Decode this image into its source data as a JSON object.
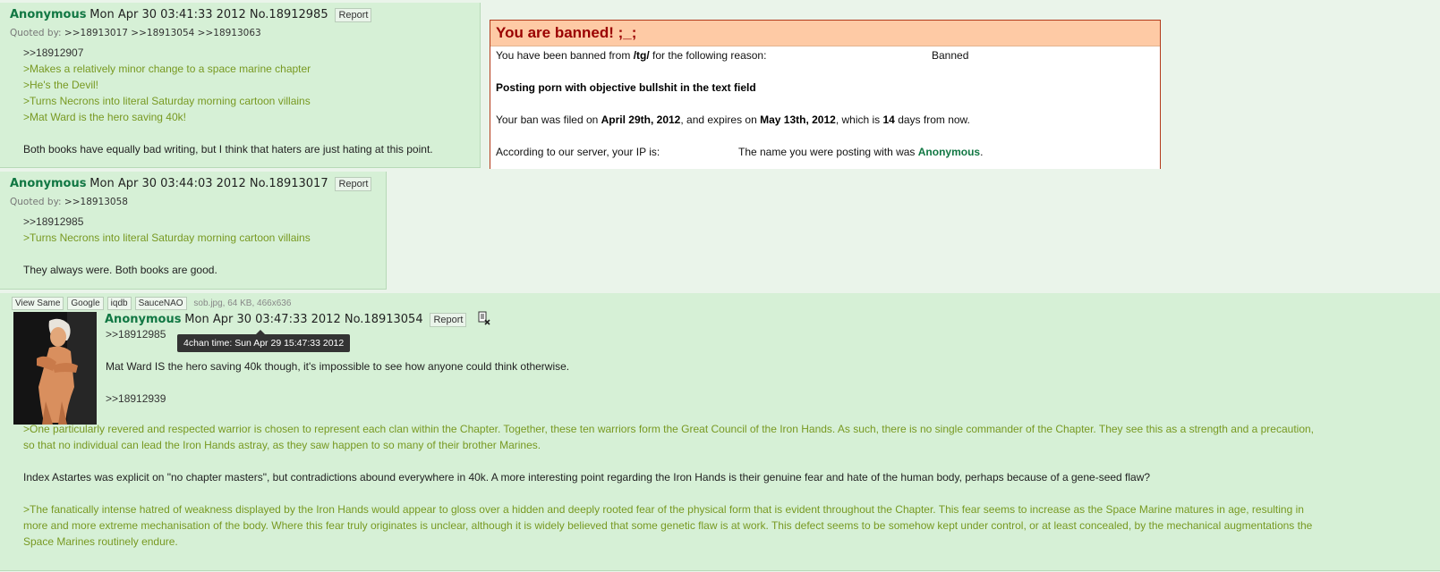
{
  "post1": {
    "name": "Anonymous",
    "date_no": "Mon Apr 30 03:41:33 2012 No.18912985",
    "report_label": "Report",
    "quoted_by_label": "Quoted by:",
    "quoted_by": ">>18913017 >>18913054 >>18913063",
    "lines": [
      ">>18912907",
      ">Makes a relatively minor change to a space marine chapter",
      ">He's the Devil!",
      ">Turns Necrons into literal Saturday morning cartoon villains",
      ">Mat Ward is the hero saving 40k!",
      "",
      "Both books have equally bad writing, but I think that haters are just hating at this point."
    ]
  },
  "ban": {
    "title": "You are banned! ;_;",
    "line1_prefix": "You have been banned from ",
    "board": "/tg/",
    "line1_suffix": " for the following reason:",
    "status": "Banned",
    "reason": "Posting porn with objective bullshit in the text field",
    "filed_prefix": "Your ban was filed on ",
    "filed_date": "April 29th, 2012",
    "expires_mid": ", and expires on ",
    "expires_date": "May 13th, 2012",
    "days_mid": ", which is ",
    "days": "14",
    "days_suffix": " days from now.",
    "ip_label": "According to our server, your IP is:",
    "name_prefix": "The name you were posting with was ",
    "name_value": "Anonymous",
    "name_suffix": "."
  },
  "post2": {
    "name": "Anonymous",
    "date_no": "Mon Apr 30 03:44:03 2012 No.18913017",
    "report_label": "Report",
    "quoted_by_label": "Quoted by:",
    "quoted_by": ">>18913058",
    "lines": [
      ">>18912985",
      ">Turns Necrons into literal Saturday morning cartoon villains",
      "",
      "They always were. Both books are good."
    ]
  },
  "post3": {
    "buttons": [
      "View Same",
      "Google",
      "iqdb",
      "SauceNAO"
    ],
    "file_info": "sob.jpg, 64 KB, 466x636",
    "name": "Anonymous",
    "date_no": "Mon Apr 30 03:47:33 2012 No.18913054",
    "report_label": "Report",
    "tooltip": "4chan time: Sun Apr 29 15:47:33 2012",
    "lines": [
      ">>18912985",
      "",
      "Mat Ward IS the hero saving 40k though, it's impossible to see how anyone could think otherwise.",
      "",
      ">>18912939",
      "",
      ">One particularly revered and respected warrior is chosen to represent each clan within the Chapter. Together, these ten warriors form the Great Council of the Iron Hands. As such, there is no single commander of the Chapter. They see this as a strength and a precaution,",
      "so that no individual can lead the Iron Hands astray, as they saw happen to so many of their brother Marines.",
      "",
      "Index Astartes was explicit on \"no chapter masters\", but contradictions abound everywhere in 40k. A more interesting point regarding the Iron Hands is their genuine fear and hate of the human body, perhaps because of a gene-seed flaw?",
      "",
      ">The fanatically intense hatred of weakness displayed by the Iron Hands would appear to gloss over a hidden and deeply rooted fear of the physical form that is evident throughout the Chapter. This fear seems to increase as the Space Marine matures in age, resulting in",
      "more and more extreme mechanisation of the body. Where this fear truly originates is unclear, although it is widely believed that some genetic flaw is at work. This defect seems to be somehow kept under control, or at least concealed, by the mechanical augmentations the",
      "Space Marines routinely endure."
    ]
  }
}
